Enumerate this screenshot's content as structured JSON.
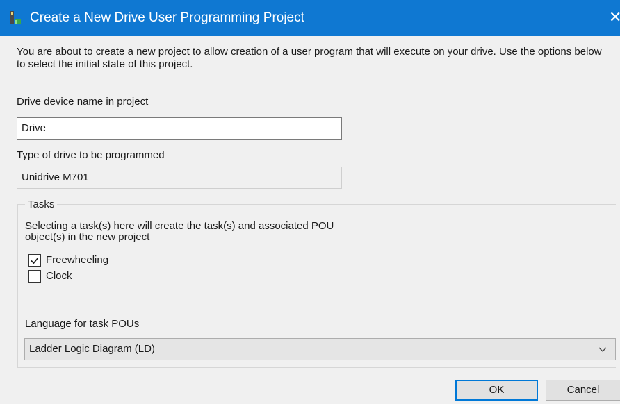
{
  "window": {
    "title": "Create a New Drive User Programming Project",
    "close_glyph": "✕"
  },
  "intro_text": "You are about to create a new project to allow creation of a user program that will execute on your drive.  Use the options below to select the initial state of this project.",
  "device_name": {
    "label": "Drive device name in project",
    "value": "Drive"
  },
  "drive_type": {
    "label": "Type of drive to be programmed",
    "value": "Unidrive M701"
  },
  "tasks": {
    "group_label": "Tasks",
    "description_line1": "Selecting a task(s) here will create the task(s) and associated POU",
    "description_line2": "object(s) in the new project",
    "items": [
      {
        "label": "Freewheeling",
        "checked": true
      },
      {
        "label": "Clock",
        "checked": false
      }
    ],
    "language_label": "Language for task POUs",
    "language_selected": "Ladder Logic Diagram (LD)"
  },
  "buttons": {
    "ok": "OK",
    "cancel": "Cancel"
  },
  "colors": {
    "titlebar": "#0f78d2",
    "dialog_bg": "#f0f0f0",
    "focus_border": "#0078d7"
  },
  "icons": {
    "app": "drive-project-icon",
    "close": "close-icon",
    "check": "checkmark-icon",
    "dropdown": "chevron-down-icon"
  }
}
